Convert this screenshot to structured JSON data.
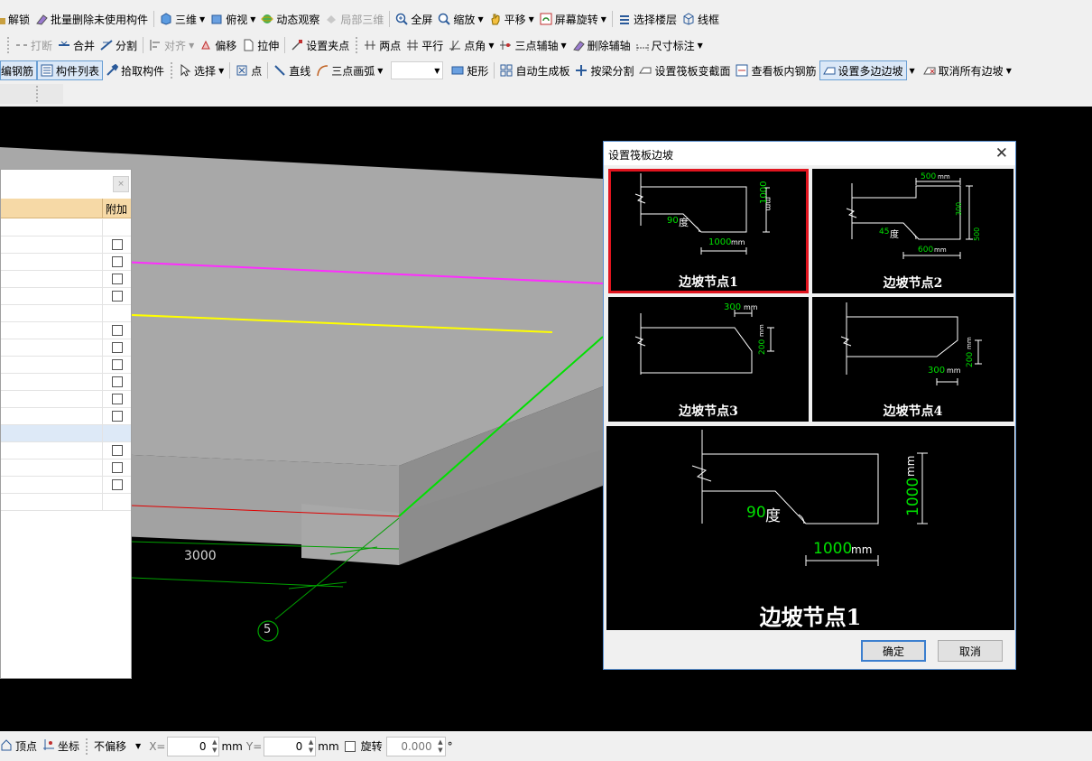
{
  "toolbar": {
    "row1": {
      "unlock": "解锁",
      "batch_delete": "批量删除未使用构件",
      "view_3d": "三维",
      "top_view": "俯视",
      "orbit": "动态观察",
      "local_3d": "局部三维",
      "full_screen": "全屏",
      "zoom": "缩放",
      "pan": "平移",
      "screen_rotate": "屏幕旋转",
      "select_floor": "选择楼层",
      "wireframe": "线框"
    },
    "row2": {
      "break": "打断",
      "merge": "合并",
      "split": "分割",
      "align": "对齐",
      "offset": "偏移",
      "stretch": "拉伸",
      "set_grip": "设置夹点",
      "two_point": "两点",
      "parallel": "平行",
      "point_angle": "点角",
      "three_point_axis": "三点辅轴",
      "delete_axis": "删除辅轴",
      "dimension": "尺寸标注"
    },
    "row3": {
      "edit_rebar": "编钢筋",
      "component_list": "构件列表",
      "pick_component": "拾取构件",
      "select": "选择",
      "point": "点",
      "line": "直线",
      "three_point_arc": "三点画弧",
      "rectangle": "矩形",
      "auto_slab": "自动生成板",
      "split_by_beam": "按梁分割",
      "set_raft_section": "设置筏板变截面",
      "view_slab_rebar": "查看板内钢筋",
      "set_multi_edge_slope": "设置多边边坡",
      "cancel_all_slopes": "取消所有边坡"
    }
  },
  "panel": {
    "close_icon": "×",
    "column_header": "附加",
    "rows": [
      {
        "checkbox": false,
        "has_checkbox": false
      },
      {
        "checkbox": false,
        "has_checkbox": true
      },
      {
        "checkbox": false,
        "has_checkbox": true
      },
      {
        "checkbox": false,
        "has_checkbox": true
      },
      {
        "checkbox": false,
        "has_checkbox": true
      },
      {
        "checkbox": false,
        "has_checkbox": false
      },
      {
        "checkbox": false,
        "has_checkbox": true
      },
      {
        "checkbox": false,
        "has_checkbox": true
      },
      {
        "checkbox": false,
        "has_checkbox": true
      },
      {
        "checkbox": false,
        "has_checkbox": true
      },
      {
        "checkbox": false,
        "has_checkbox": true
      },
      {
        "checkbox": false,
        "has_checkbox": true
      },
      {
        "checkbox": false,
        "has_checkbox": false,
        "selected": true
      },
      {
        "checkbox": false,
        "has_checkbox": true
      },
      {
        "checkbox": false,
        "has_checkbox": true
      },
      {
        "checkbox": false,
        "has_checkbox": true
      },
      {
        "checkbox": false,
        "has_checkbox": false
      }
    ]
  },
  "viewport": {
    "dimension_text": "3000",
    "axis_label": "5",
    "colors": {
      "slab_top": "#a8a8a8",
      "slab_side_dark": "#8c8c8c",
      "magenta": "#ff2cff",
      "yellow": "#ffff00",
      "green": "#00e000",
      "red": "#e00000",
      "dim_green": "#00a000"
    }
  },
  "dialog": {
    "title": "设置筏板边坡",
    "thumbs": [
      {
        "label": "边坡节点1",
        "angle": "90",
        "deg": "度",
        "dim": "1000",
        "unit": "mm",
        "height": "1000"
      },
      {
        "label": "边坡节点2",
        "angle": "45",
        "deg": "度",
        "top_dim": "500",
        "height_dim": "300",
        "right_dim": "500",
        "bottom_dim": "600",
        "unit": "mm"
      },
      {
        "label": "边坡节点3",
        "top_dim": "300",
        "height": "200",
        "unit": "mm"
      },
      {
        "label": "边坡节点4",
        "bottom_dim": "300",
        "height": "200",
        "unit": "mm"
      }
    ],
    "preview": {
      "label": "边坡节点1",
      "angle": "90",
      "deg": "度",
      "dim": "1000",
      "unit": "mm",
      "height": "1000"
    },
    "ok": "确定",
    "cancel": "取消",
    "accent_color": "#e0141e",
    "dim_color": "#00e000"
  },
  "statusbar": {
    "vertex": "顶点",
    "coordinate": "坐标",
    "offset_mode": "不偏移",
    "x_label": "X=",
    "x_value": "0",
    "unit_x": "mm",
    "y_label": "Y=",
    "y_value": "0",
    "unit_y": "mm",
    "rotate": "旋转",
    "rotate_value": "0.000",
    "degree": "°"
  }
}
